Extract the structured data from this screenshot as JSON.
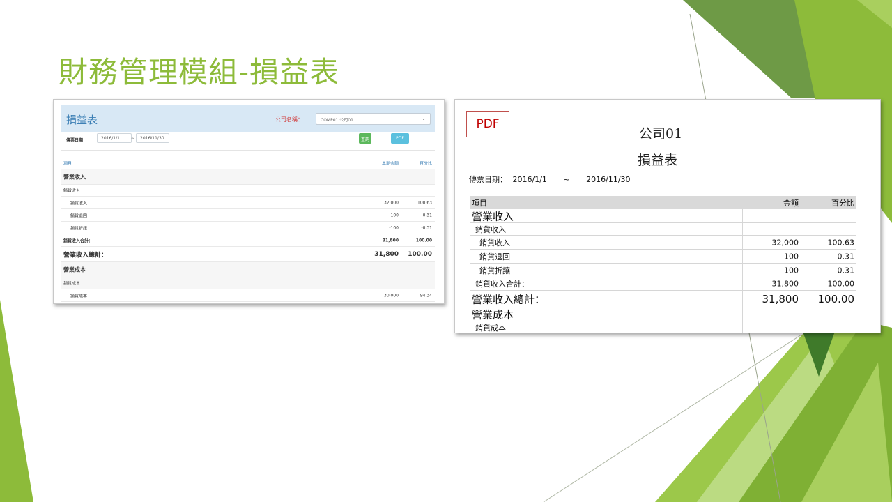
{
  "slide": {
    "title": "財務管理模組-損益表"
  },
  "colors": {
    "title_green": "#8dbb3a",
    "ui_header_bg": "#d8e8f5",
    "ui_title_blue": "#3c7fb5",
    "query_button": "#5cb85c",
    "pdf_button": "#5bc0de",
    "pdf_badge_red": "#c00000"
  },
  "web_ui": {
    "title": "損益表",
    "company_label": "公司名稱：",
    "company_select_value": "COMP01 公司01",
    "date_label": "傳票日期",
    "date_from": "2016/1/1",
    "date_tilde": "~",
    "date_to": "2016/11/30",
    "query_button": "查詢",
    "pdf_button": "PDF",
    "columns": {
      "item": "項目",
      "amount": "本期金額",
      "percent": "百分比"
    },
    "rows": [
      {
        "label": "營業收入",
        "amount": "",
        "percent": "",
        "level": "section"
      },
      {
        "label": "銷貨收入",
        "amount": "",
        "percent": "",
        "level": "group"
      },
      {
        "label": "銷貨收入",
        "amount": "32,000",
        "percent": "100.63",
        "level": "item"
      },
      {
        "label": "銷貨退回",
        "amount": "-100",
        "percent": "-0.31",
        "level": "item"
      },
      {
        "label": "銷貨折讓",
        "amount": "-100",
        "percent": "-0.31",
        "level": "item"
      },
      {
        "label": "銷貨收入合計：",
        "amount": "31,800",
        "percent": "100.00",
        "level": "subtotal"
      },
      {
        "label": "營業收入總計：",
        "amount": "31,800",
        "percent": "100.00",
        "level": "total"
      },
      {
        "label": "營業成本",
        "amount": "",
        "percent": "",
        "level": "section"
      },
      {
        "label": "銷貨成本",
        "amount": "",
        "percent": "",
        "level": "group"
      },
      {
        "label": "銷貨成本",
        "amount": "30,000",
        "percent": "94.34",
        "level": "item"
      }
    ]
  },
  "pdf_view": {
    "badge": "PDF",
    "company": "公司01",
    "title": "損益表",
    "date_label": "傳票日期：",
    "date_from": "2016/1/1",
    "date_tilde": "~",
    "date_to": "2016/11/30",
    "columns": {
      "item": "項目",
      "amount": "金額",
      "percent": "百分比"
    },
    "rows": [
      {
        "label": "營業收入",
        "amount": "",
        "percent": "",
        "level": "section"
      },
      {
        "label": "銷貨收入",
        "amount": "",
        "percent": "",
        "level": "group"
      },
      {
        "label": "銷貨收入",
        "amount": "32,000",
        "percent": "100.63",
        "level": "item"
      },
      {
        "label": "銷貨退回",
        "amount": "-100",
        "percent": "-0.31",
        "level": "item"
      },
      {
        "label": "銷貨折讓",
        "amount": "-100",
        "percent": "-0.31",
        "level": "item"
      },
      {
        "label": "銷貨收入合計：",
        "amount": "31,800",
        "percent": "100.00",
        "level": "subtotal"
      },
      {
        "label": "營業收入總計：",
        "amount": "31,800",
        "percent": "100.00",
        "level": "total"
      },
      {
        "label": "營業成本",
        "amount": "",
        "percent": "",
        "level": "section"
      },
      {
        "label": "銷貨成本",
        "amount": "",
        "percent": "",
        "level": "group"
      }
    ]
  }
}
